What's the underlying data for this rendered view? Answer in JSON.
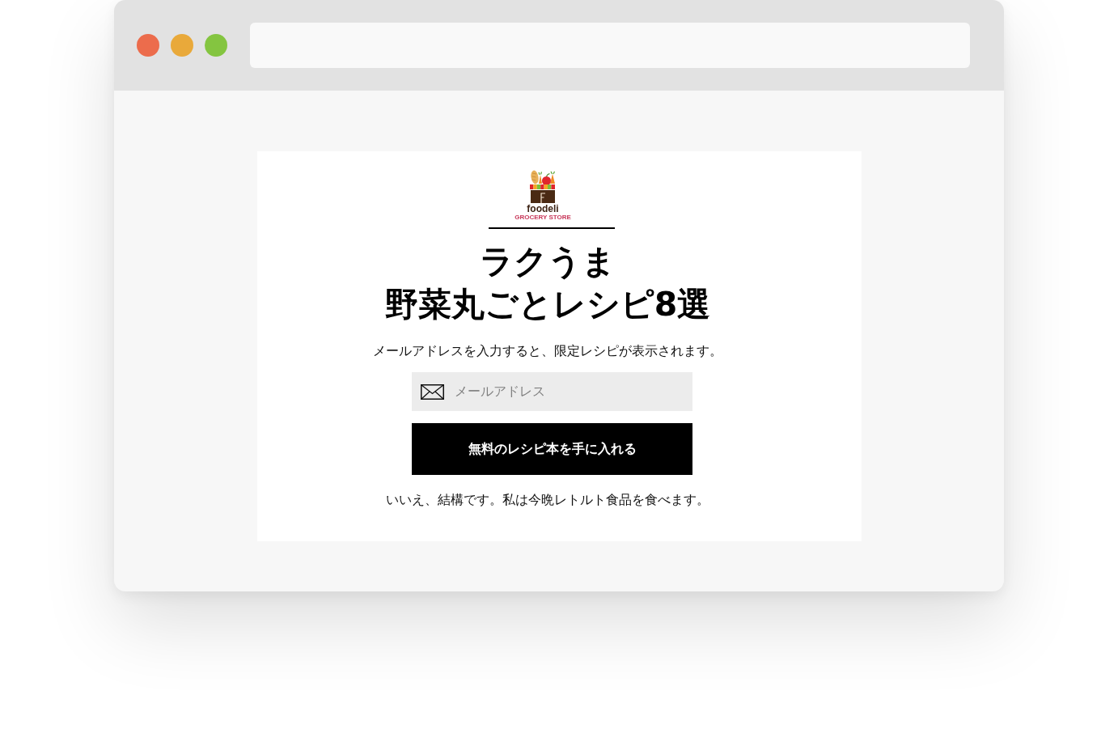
{
  "browser": {
    "traffic_lights": [
      {
        "color": "#ec6c4c"
      },
      {
        "color": "#e9a93a"
      },
      {
        "color": "#84c540"
      }
    ]
  },
  "logo": {
    "name": "foodeli",
    "tagline": "GROCERY STORE"
  },
  "headline_lines": [
    "ラクうま",
    "野菜丸ごとレシピ8選"
  ],
  "intro": "メールアドレスを入力すると、限定レシピが表示されます。",
  "email_field": {
    "placeholder": "メールアドレス"
  },
  "submit_button": "無料のレシピ本を手に入れる",
  "decline_link": "いいえ、結構です。私は今晩レトルト食品を食べます。"
}
